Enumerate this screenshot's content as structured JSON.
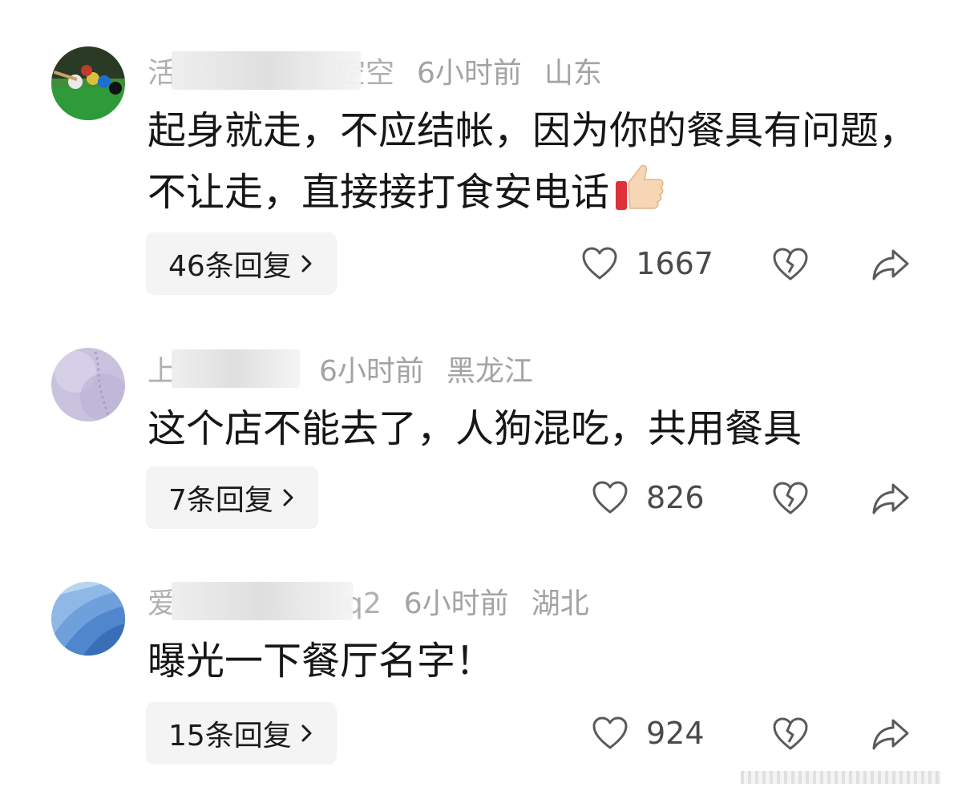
{
  "comments": [
    {
      "username": "活",
      "username_tail": "空空",
      "time": "6小时前",
      "location": "山东",
      "text": "起身就走，不应结帐，因为你的餐具有问题，不让走，直接接打食安电话",
      "emoji": "thumbs-up-icon",
      "reply_label": "46条回复",
      "likes": "1667",
      "avatar": "billiards-avatar"
    },
    {
      "username": "上",
      "username_tail": "",
      "time": "6小时前",
      "location": "黑龙江",
      "text": "这个店不能去了，人狗混吃，共用餐具",
      "reply_label": "7条回复",
      "likes": "826",
      "avatar": "snow-avatar"
    },
    {
      "username": "爱",
      "username_tail": "q2",
      "time": "6小时前",
      "location": "湖北",
      "text": "曝光一下餐厅名字！",
      "reply_label": "15条回复",
      "likes": "924",
      "avatar": "blue-wave-avatar"
    }
  ],
  "colors": {
    "meta_text": "#a3a3a3",
    "body_text": "#161616",
    "reply_bg": "#f4f4f4",
    "icon_stroke": "#5a5a5a"
  }
}
